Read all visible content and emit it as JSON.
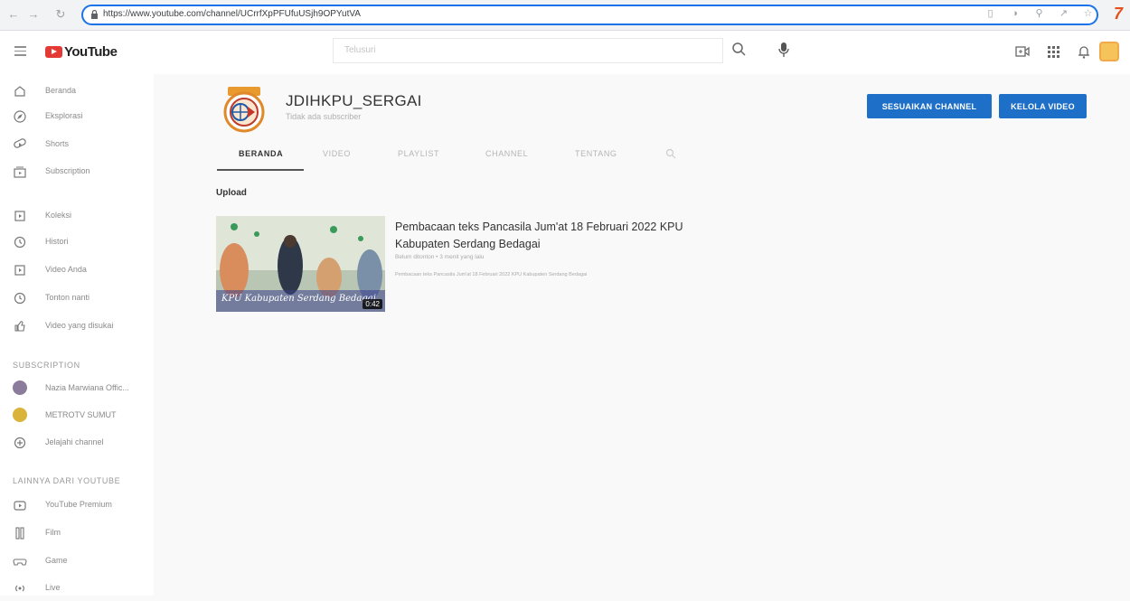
{
  "browser": {
    "url": "https://www.youtube.com/channel/UCrrfXpPFUfuUSjh9OPYutVA"
  },
  "header": {
    "logo_text": "YouTube",
    "search_placeholder": "Telusuri"
  },
  "sidebar": {
    "main_items": [
      {
        "label": "Beranda",
        "icon": "home-icon"
      },
      {
        "label": "Eksplorasi",
        "icon": "explore-icon"
      },
      {
        "label": "Shorts",
        "icon": "shorts-icon"
      },
      {
        "label": "Subscription",
        "icon": "subscriptions-icon"
      }
    ],
    "library_items": [
      {
        "label": "Koleksi",
        "icon": "library-icon"
      },
      {
        "label": "Histori",
        "icon": "history-icon"
      },
      {
        "label": "Video Anda",
        "icon": "your-videos-icon"
      },
      {
        "label": "Tonton nanti",
        "icon": "watch-later-icon"
      },
      {
        "label": "Video yang disukai",
        "icon": "liked-icon"
      }
    ],
    "subscription_heading": "SUBSCRIPTION",
    "subscriptions": [
      {
        "label": "Nazia Marwiana Offic..."
      },
      {
        "label": "METROTV SUMUT"
      },
      {
        "label": "Jelajahi channel"
      }
    ],
    "more_heading": "LAINNYA DARI YOUTUBE",
    "more_items": [
      {
        "label": "YouTube Premium",
        "icon": "premium-icon"
      },
      {
        "label": "Film",
        "icon": "film-icon"
      },
      {
        "label": "Game",
        "icon": "game-icon"
      },
      {
        "label": "Live",
        "icon": "live-icon"
      }
    ]
  },
  "channel": {
    "name": "JDIHKPU_SERGAI",
    "subscribers": "Tidak ada subscriber",
    "customize_label": "SESUAIKAN CHANNEL",
    "manage_label": "KELOLA VIDEO",
    "tabs": [
      "BERANDA",
      "VIDEO",
      "PLAYLIST",
      "CHANNEL",
      "TENTANG"
    ],
    "active_tab": "BERANDA",
    "section_title": "Upload"
  },
  "video": {
    "title": "Pembacaan teks Pancasila Jum'at 18 Februari 2022 KPU Kabupaten Serdang Bedagai",
    "meta": "Belum ditonton • 3 menit yang lalu",
    "description": "Pembacaan teks Pancasila Jum'at 18 Februari 2022 KPU Kabupaten Serdang Bedagai",
    "thumb_caption": "KPU Kabupaten Serdang Bedagai",
    "duration": "0:42"
  },
  "colors": {
    "accent_blue": "#1e6fc8",
    "youtube_red": "#e53935"
  }
}
